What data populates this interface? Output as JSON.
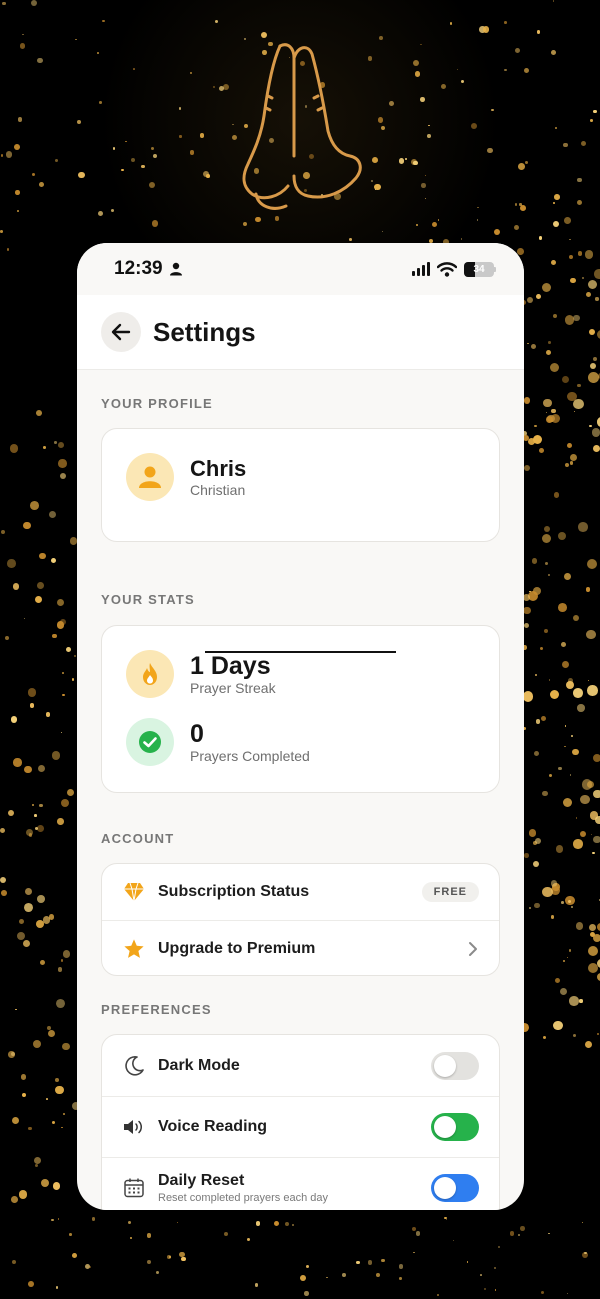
{
  "status_bar": {
    "time": "12:39",
    "battery": "34"
  },
  "header": {
    "title": "Settings"
  },
  "profile": {
    "section_label": "YOUR PROFILE",
    "name": "Chris",
    "role": "Christian"
  },
  "stats": {
    "section_label": "YOUR STATS",
    "streak_value": "1 Days",
    "streak_label": "Prayer Streak",
    "completed_value": "0",
    "completed_label": "Prayers Completed"
  },
  "account": {
    "section_label": "ACCOUNT",
    "subscription_label": "Subscription Status",
    "subscription_badge": "FREE",
    "upgrade_label": "Upgrade to Premium"
  },
  "preferences": {
    "section_label": "PREFERENCES",
    "items": [
      {
        "label": "Dark Mode",
        "enabled": false
      },
      {
        "label": "Voice Reading",
        "enabled": true
      },
      {
        "label": "Daily Reset",
        "sublabel": "Reset completed prayers each day",
        "enabled": true
      }
    ]
  },
  "colors": {
    "accent_gold": "#f2a51a",
    "toggle_green": "#26b24b",
    "toggle_blue": "#2f7ef0",
    "background": "#000000"
  },
  "icons": [
    "praying-hands-icon",
    "person-icon",
    "signal-icon",
    "wifi-icon",
    "battery-icon",
    "back-arrow-icon",
    "user-icon",
    "flame-icon",
    "check-circle-icon",
    "diamond-icon",
    "star-icon",
    "chevron-right-icon",
    "moon-icon",
    "speaker-icon",
    "calendar-icon"
  ]
}
